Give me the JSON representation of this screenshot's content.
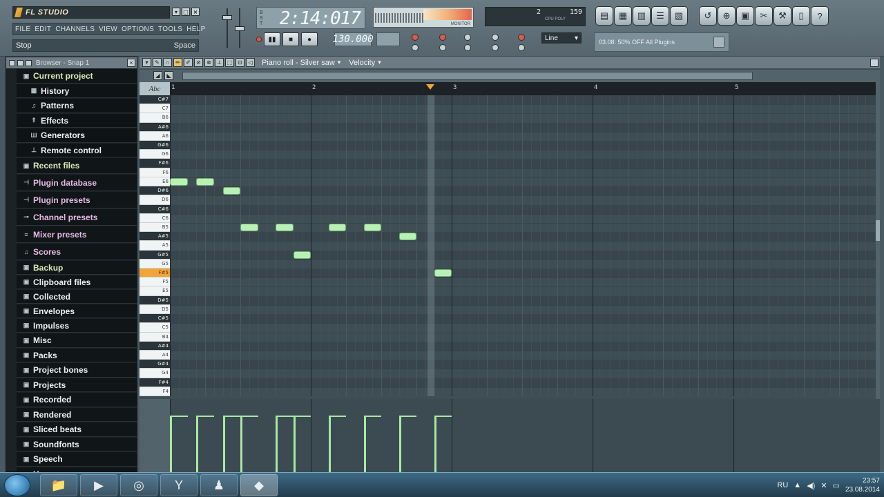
{
  "app": {
    "logo_text": "FL STUDIO",
    "menu": [
      "FILE",
      "EDIT",
      "CHANNELS",
      "VIEW",
      "OPTIONS",
      "TOOLS",
      "HELP"
    ],
    "hint_left": "Stop",
    "hint_right": "Space",
    "song_time": "2:14:017",
    "tempo": "130.000",
    "cpu_value": "2",
    "poly_value": "159",
    "scope_label": "MONITOR",
    "snap_mode": "Line",
    "news_text": "03.08: 50% OFF All Plugins"
  },
  "browser": {
    "title": "Browser - Snap 1",
    "items": [
      {
        "label": "Current project",
        "icon": "folder-icon",
        "sub": false
      },
      {
        "label": "History",
        "icon": "history-icon",
        "sub": true
      },
      {
        "label": "Patterns",
        "icon": "note-icon",
        "sub": true
      },
      {
        "label": "Effects",
        "icon": "effects-icon",
        "sub": true
      },
      {
        "label": "Generators",
        "icon": "generators-icon",
        "sub": true
      },
      {
        "label": "Remote control",
        "icon": "remote-icon",
        "sub": true
      },
      {
        "label": "Recent files",
        "icon": "folder-icon",
        "sub": false
      },
      {
        "label": "Plugin database",
        "icon": "plugin-icon",
        "sub": false
      },
      {
        "label": "Plugin presets",
        "icon": "plugin-icon",
        "sub": false
      },
      {
        "label": "Channel presets",
        "icon": "channel-icon",
        "sub": false
      },
      {
        "label": "Mixer presets",
        "icon": "mixer-icon",
        "sub": false
      },
      {
        "label": "Scores",
        "icon": "note-icon",
        "sub": false
      },
      {
        "label": "Backup",
        "icon": "folder-icon",
        "sub": false
      },
      {
        "label": "Clipboard files",
        "icon": "folder-icon",
        "sub": false
      },
      {
        "label": "Collected",
        "icon": "folder-icon",
        "sub": false
      },
      {
        "label": "Envelopes",
        "icon": "folder-icon",
        "sub": false
      },
      {
        "label": "Impulses",
        "icon": "folder-icon",
        "sub": false
      },
      {
        "label": "Misc",
        "icon": "folder-icon",
        "sub": false
      },
      {
        "label": "Packs",
        "icon": "folder-icon",
        "sub": false
      },
      {
        "label": "Project bones",
        "icon": "folder-icon",
        "sub": false
      },
      {
        "label": "Projects",
        "icon": "folder-icon",
        "sub": false
      },
      {
        "label": "Recorded",
        "icon": "folder-icon",
        "sub": false
      },
      {
        "label": "Rendered",
        "icon": "folder-icon",
        "sub": false
      },
      {
        "label": "Sliced beats",
        "icon": "folder-icon",
        "sub": false
      },
      {
        "label": "Soundfonts",
        "icon": "folder-icon",
        "sub": false
      },
      {
        "label": "Speech",
        "icon": "folder-icon",
        "sub": false
      },
      {
        "label": "User",
        "icon": "user-icon",
        "sub": false
      }
    ]
  },
  "piano_roll": {
    "title": "Piano roll - Silver saw",
    "view": "Velocity",
    "ruler_label": "Abc",
    "bars": [
      "1",
      "2",
      "3",
      "4",
      "5"
    ],
    "playhead_bar": 2.85,
    "keys": [
      "C#7",
      "C7",
      "B6",
      "A#6",
      "A6",
      "G#6",
      "G6",
      "F#6",
      "F6",
      "E6",
      "D#6",
      "D6",
      "C#6",
      "C6",
      "B5",
      "A#5",
      "A5",
      "G#5",
      "G5",
      "F#5",
      "F5",
      "E5",
      "D#5",
      "D5",
      "C#5",
      "C5",
      "B4",
      "A#4",
      "A4",
      "G#4",
      "G4",
      "F#4",
      "F4"
    ],
    "highlight_key": "F#5",
    "notes": [
      {
        "pitch": "E6",
        "start": 0.0,
        "len": 0.125
      },
      {
        "pitch": "E6",
        "start": 0.1875,
        "len": 0.125
      },
      {
        "pitch": "D#6",
        "start": 0.375,
        "len": 0.125
      },
      {
        "pitch": "B5",
        "start": 0.5,
        "len": 0.125
      },
      {
        "pitch": "B5",
        "start": 0.75,
        "len": 0.125
      },
      {
        "pitch": "G#5",
        "start": 0.875,
        "len": 0.125
      },
      {
        "pitch": "B5",
        "start": 1.125,
        "len": 0.125
      },
      {
        "pitch": "B5",
        "start": 1.375,
        "len": 0.125
      },
      {
        "pitch": "A#5",
        "start": 1.625,
        "len": 0.125
      },
      {
        "pitch": "F#5",
        "start": 1.875,
        "len": 0.125
      }
    ]
  },
  "taskbar": {
    "lang": "RU",
    "time": "23:57",
    "date": "23.08.2014"
  }
}
